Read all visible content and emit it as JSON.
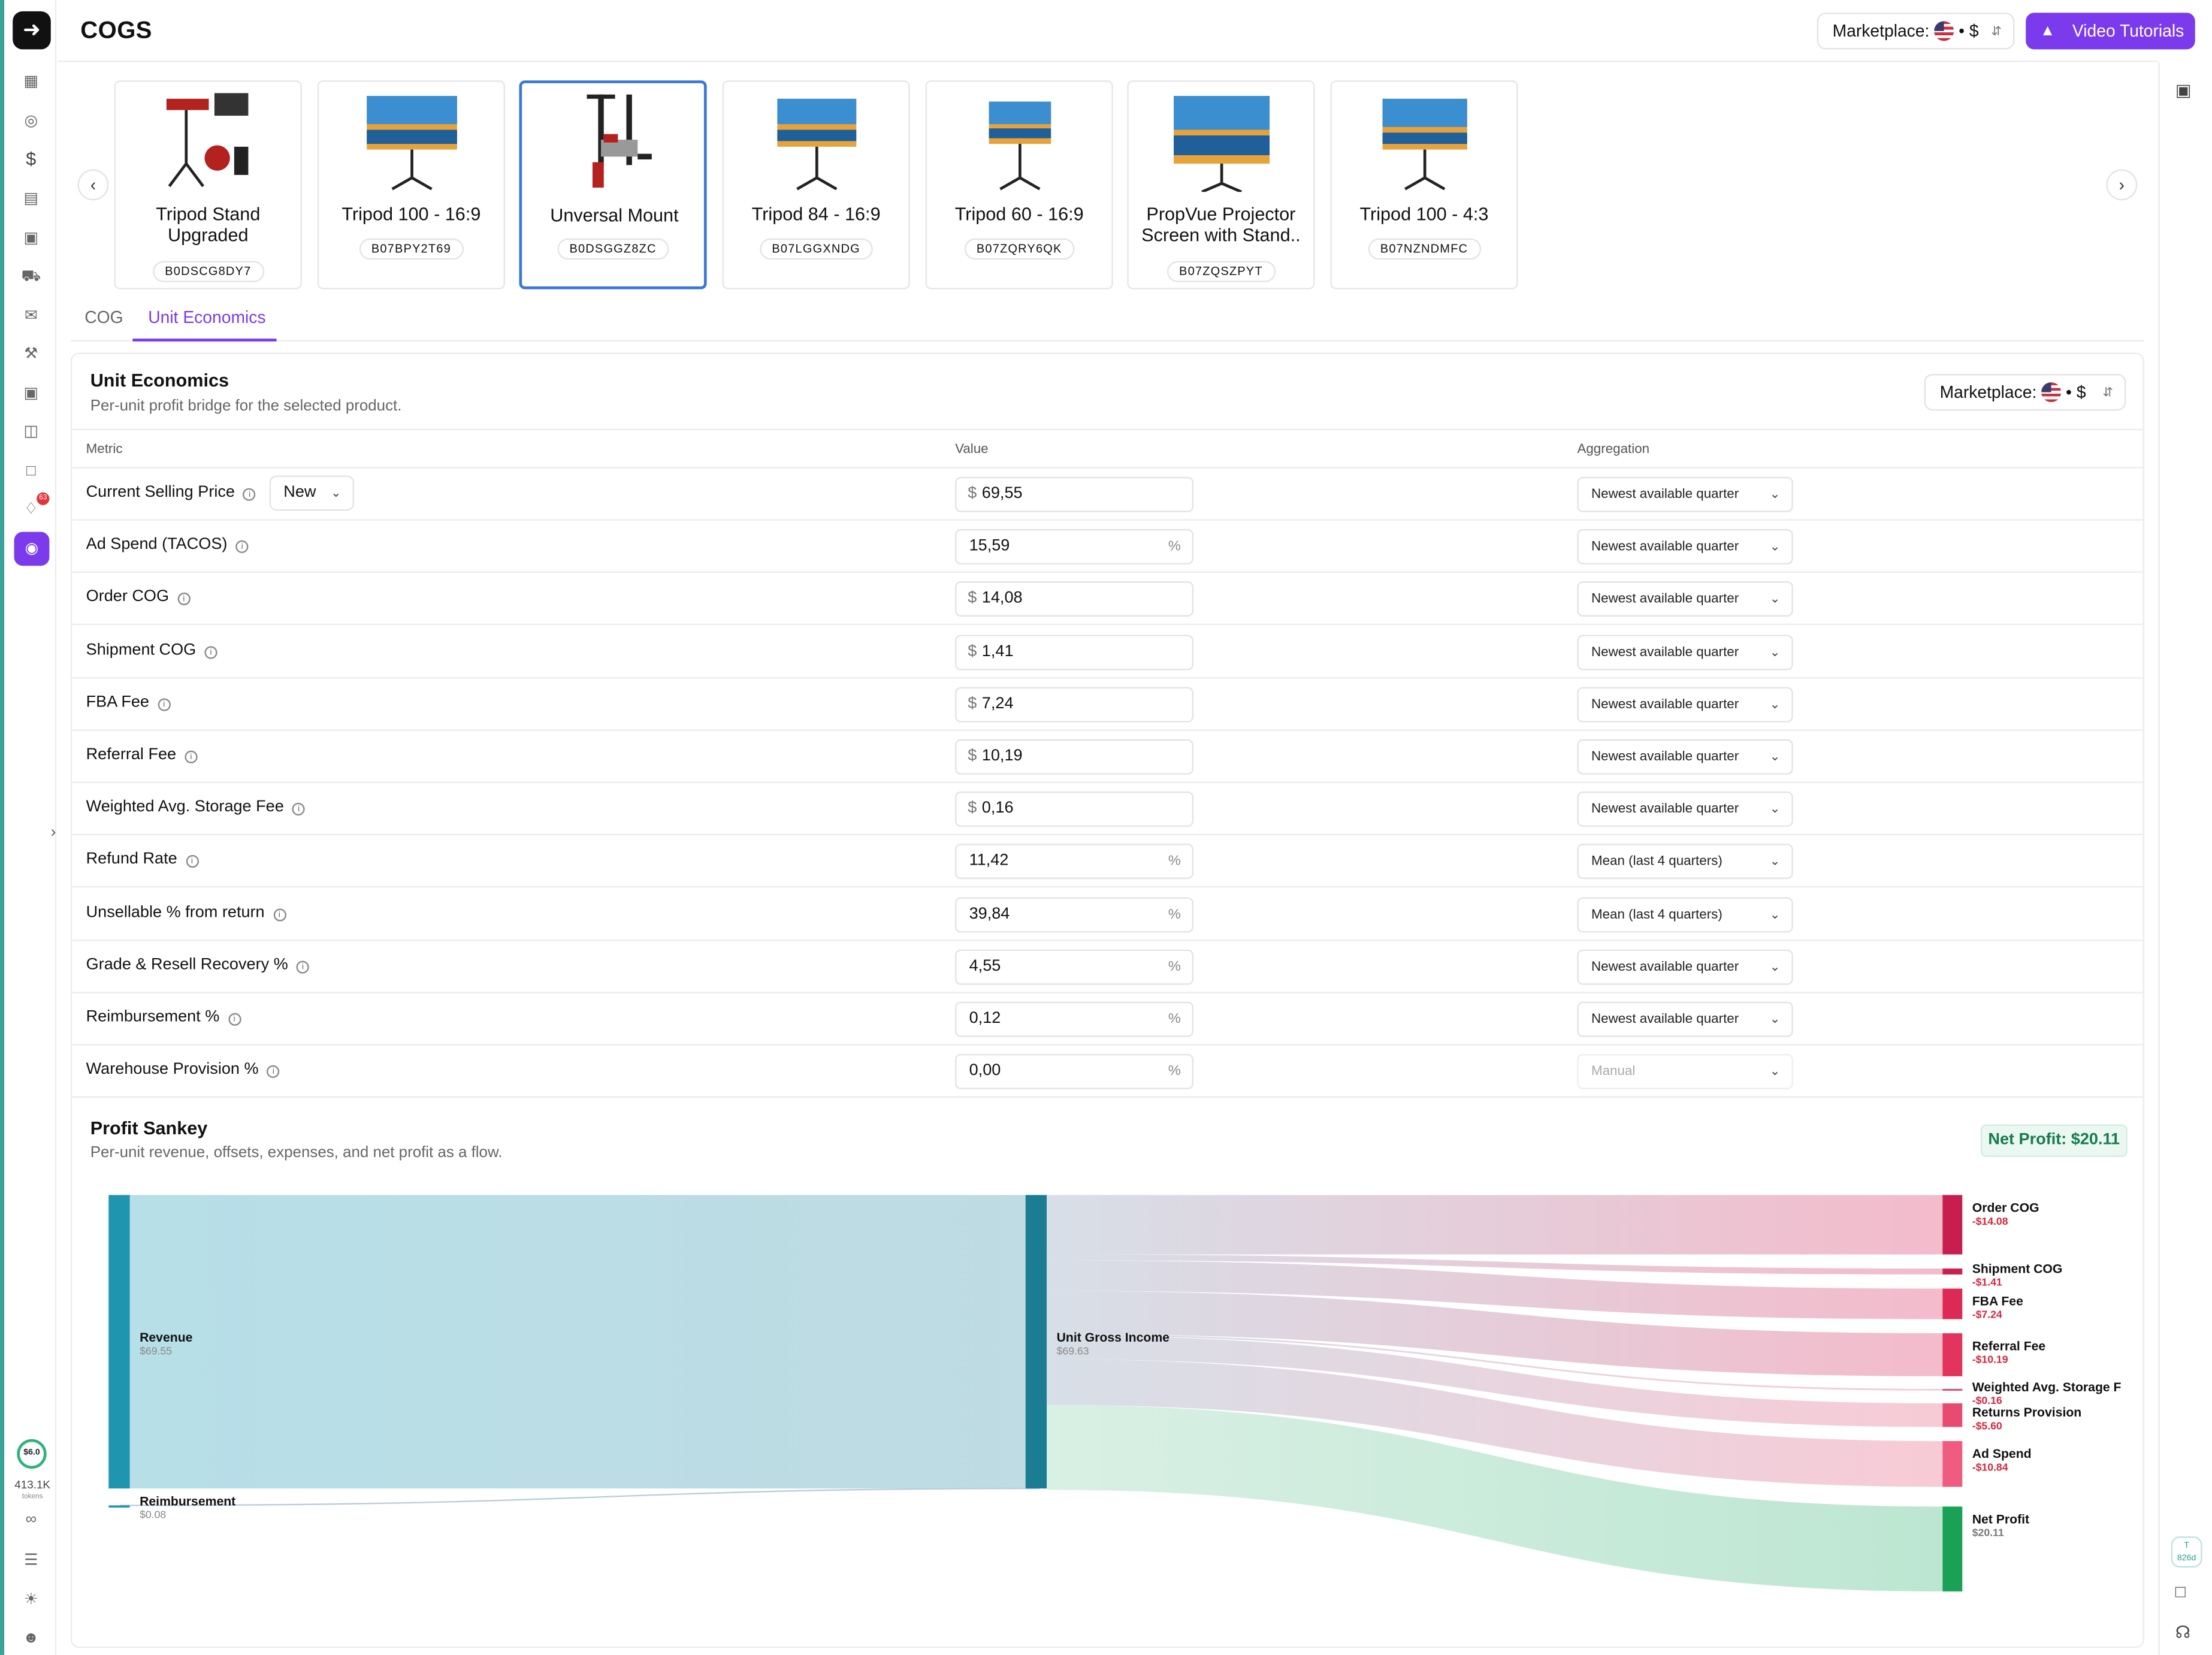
{
  "header": {
    "title": "COGS",
    "marketplace_label": "Marketplace:",
    "marketplace_currency": "$",
    "video_tutorials_label": "Video Tutorials"
  },
  "sidebar": {
    "notifications_badge": "63",
    "tokens_value": "$6.0",
    "tokens_count": "413.1K",
    "tokens_label": "tokens"
  },
  "right_rail": {
    "badge_top": "T",
    "badge_value": "826d"
  },
  "products": [
    {
      "name": "Tripod Stand Upgraded",
      "sku": "B0DSCG8DY7"
    },
    {
      "name": "Tripod 100 - 16:9",
      "sku": "B07BPY2T69"
    },
    {
      "name": "Unversal Mount",
      "sku": "B0DSGGZ8ZC"
    },
    {
      "name": "Tripod 84 - 16:9",
      "sku": "B07LGGXNDG"
    },
    {
      "name": "Tripod 60 - 16:9",
      "sku": "B07ZQRY6QK"
    },
    {
      "name": "PropVue Projector Screen with Stand..",
      "sku": "B07ZQSZPYT"
    },
    {
      "name": "Tripod 100 - 4:3",
      "sku": "B07NZNDMFC"
    }
  ],
  "tabs": [
    {
      "label": "COG"
    },
    {
      "label": "Unit Economics"
    }
  ],
  "unit_economics": {
    "title": "Unit Economics",
    "subtitle": "Per-unit profit bridge for the selected product.",
    "marketplace_label": "Marketplace:",
    "marketplace_currency": "$",
    "columns": {
      "metric": "Metric",
      "value": "Value",
      "aggregation": "Aggregation"
    },
    "condition": "New",
    "rows": [
      {
        "metric": "Current Selling Price",
        "prefix": "$",
        "value": "69,55",
        "suffix": "",
        "aggregation": "Newest available quarter"
      },
      {
        "metric": "Ad Spend (TACOS)",
        "prefix": "",
        "value": "15,59",
        "suffix": "%",
        "aggregation": "Newest available quarter"
      },
      {
        "metric": "Order COG",
        "prefix": "$",
        "value": "14,08",
        "suffix": "",
        "aggregation": "Newest available quarter"
      },
      {
        "metric": "Shipment COG",
        "prefix": "$",
        "value": "1,41",
        "suffix": "",
        "aggregation": "Newest available quarter"
      },
      {
        "metric": "FBA Fee",
        "prefix": "$",
        "value": "7,24",
        "suffix": "",
        "aggregation": "Newest available quarter"
      },
      {
        "metric": "Referral Fee",
        "prefix": "$",
        "value": "10,19",
        "suffix": "",
        "aggregation": "Newest available quarter"
      },
      {
        "metric": "Weighted Avg. Storage Fee",
        "prefix": "$",
        "value": "0,16",
        "suffix": "",
        "aggregation": "Newest available quarter"
      },
      {
        "metric": "Refund Rate",
        "prefix": "",
        "value": "11,42",
        "suffix": "%",
        "aggregation": "Mean (last 4 quarters)"
      },
      {
        "metric": "Unsellable % from return",
        "prefix": "",
        "value": "39,84",
        "suffix": "%",
        "aggregation": "Mean (last 4 quarters)"
      },
      {
        "metric": "Grade & Resell Recovery %",
        "prefix": "",
        "value": "4,55",
        "suffix": "%",
        "aggregation": "Newest available quarter"
      },
      {
        "metric": "Reimbursement %",
        "prefix": "",
        "value": "0,12",
        "suffix": "%",
        "aggregation": "Newest available quarter"
      },
      {
        "metric": "Warehouse Provision %",
        "prefix": "",
        "value": "0,00",
        "suffix": "%",
        "aggregation": "Manual"
      }
    ]
  },
  "sankey": {
    "title": "Profit Sankey",
    "subtitle": "Per-unit revenue, offsets, expenses, and net profit as a flow.",
    "net_profit_badge": "Net Profit: $20.11",
    "nodes": {
      "revenue": {
        "label": "Revenue",
        "value": "$69.55"
      },
      "reimbursement": {
        "label": "Reimbursement",
        "value": "$0.08"
      },
      "gross": {
        "label": "Unit Gross Income",
        "value": "$69.63"
      }
    },
    "outputs": [
      {
        "label": "Order COG",
        "value": "-$14.08",
        "amount": 14.08,
        "color": "#c81e4f"
      },
      {
        "label": "Shipment COG",
        "value": "-$1.41",
        "amount": 1.41,
        "color": "#cc1f4f"
      },
      {
        "label": "FBA Fee",
        "value": "-$7.24",
        "amount": 7.24,
        "color": "#dd2a55"
      },
      {
        "label": "Referral Fee",
        "value": "-$10.19",
        "amount": 10.19,
        "color": "#e2345d"
      },
      {
        "label": "Weighted Avg. Storage F",
        "value": "-$0.16",
        "amount": 0.16,
        "color": "#e53e66"
      },
      {
        "label": "Returns Provision",
        "value": "-$5.60",
        "amount": 5.6,
        "color": "#e94b70"
      },
      {
        "label": "Ad Spend",
        "value": "-$10.84",
        "amount": 10.84,
        "color": "#f05c7f"
      },
      {
        "label": "Net Profit",
        "value": "$20.11",
        "amount": 20.11,
        "color": "#1aa155"
      }
    ]
  }
}
